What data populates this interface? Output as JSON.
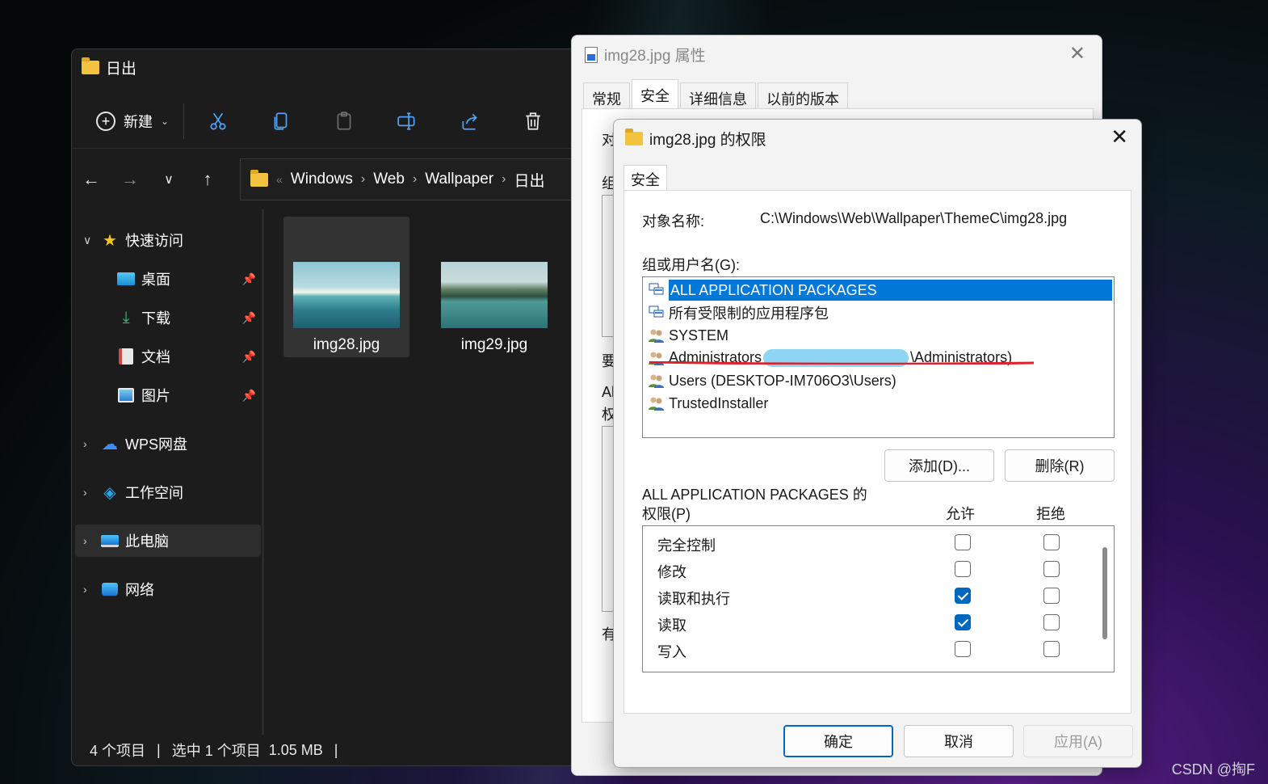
{
  "watermark": "CSDN @掏F",
  "explorer": {
    "title": "日出",
    "toolbar": {
      "new_label": "新建"
    },
    "address": {
      "parts": [
        "Windows",
        "Web",
        "Wallpaper",
        "日出"
      ]
    },
    "sidebar": {
      "quick_access": "快速访问",
      "items": [
        {
          "label": "桌面"
        },
        {
          "label": "下载"
        },
        {
          "label": "文档"
        },
        {
          "label": "图片"
        }
      ],
      "wps": "WPS网盘",
      "workspace": "工作空间",
      "this_pc": "此电脑",
      "network": "网络"
    },
    "files": [
      {
        "name": "img28.jpg"
      },
      {
        "name": "img29.jpg"
      }
    ],
    "status": {
      "count": "4 个项目",
      "selected": "选中 1 个项目",
      "size": "1.05 MB"
    }
  },
  "props": {
    "title": "img28.jpg 属性",
    "tabs": [
      "常规",
      "安全",
      "详细信息",
      "以前的版本"
    ],
    "partial_labels": [
      "对",
      "组",
      "要",
      "Al",
      "权",
      "有"
    ]
  },
  "perm": {
    "title": "img28.jpg 的权限",
    "tab": "安全",
    "object_label": "对象名称:",
    "object_value": "C:\\Windows\\Web\\Wallpaper\\ThemeC\\img28.jpg",
    "group_label": "组或用户名(G):",
    "users": [
      {
        "name": "ALL APPLICATION PACKAGES"
      },
      {
        "name": "所有受限制的应用程序包"
      },
      {
        "name": "SYSTEM"
      },
      {
        "name_prefix": "Administrators",
        "name_suffix": "\\Administrators)"
      },
      {
        "name": "Users (DESKTOP-IM706O3\\Users)"
      },
      {
        "name": "TrustedInstaller"
      }
    ],
    "add_button": "添加(D)...",
    "remove_button": "删除(R)",
    "perm_header_line1": "ALL APPLICATION PACKAGES 的",
    "perm_header_line2": "权限(P)",
    "allow_label": "允许",
    "deny_label": "拒绝",
    "permissions": [
      {
        "name": "完全控制",
        "allow": false,
        "deny": false
      },
      {
        "name": "修改",
        "allow": false,
        "deny": false
      },
      {
        "name": "读取和执行",
        "allow": true,
        "deny": false
      },
      {
        "name": "读取",
        "allow": true,
        "deny": false
      },
      {
        "name": "写入",
        "allow": false,
        "deny": false
      }
    ],
    "ok_button": "确定",
    "cancel_button": "取消",
    "apply_button": "应用(A)"
  }
}
